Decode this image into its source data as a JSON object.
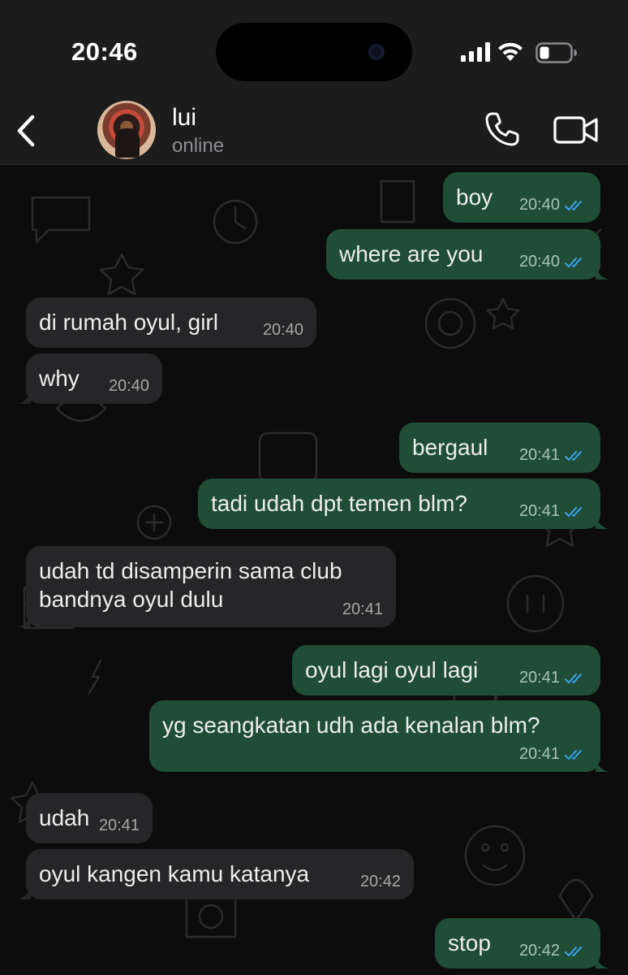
{
  "status_bar": {
    "time": "20:46",
    "icons": [
      "signal-icon",
      "wifi-icon",
      "battery-icon"
    ]
  },
  "header": {
    "contact_name": "lui",
    "contact_status": "online",
    "icons": [
      "back-chevron-icon",
      "phone-icon",
      "video-camera-icon"
    ]
  },
  "colors": {
    "outgoing_bubble": "#1f4d36",
    "incoming_bubble": "#262628",
    "read_ticks": "#3aa3f0"
  },
  "messages": [
    {
      "dir": "out",
      "text": "boy",
      "time": "20:40",
      "read": true
    },
    {
      "dir": "out",
      "text": "where are you",
      "time": "20:40",
      "read": true
    },
    {
      "dir": "in",
      "text": "di rumah oyul, girl",
      "time": "20:40"
    },
    {
      "dir": "in",
      "text": "why",
      "time": "20:40"
    },
    {
      "dir": "out",
      "text": "bergaul",
      "time": "20:41",
      "read": true
    },
    {
      "dir": "out",
      "text": "tadi udah dpt temen blm?",
      "time": "20:41",
      "read": true
    },
    {
      "dir": "in",
      "text_lines": [
        "udah td disamperin sama club",
        "bandnya oyul dulu"
      ],
      "time": "20:41"
    },
    {
      "dir": "out",
      "text": "oyul lagi oyul lagi",
      "time": "20:41",
      "read": true
    },
    {
      "dir": "out",
      "text": "yg seangkatan udh ada kenalan blm?",
      "time": "20:41",
      "read": true
    },
    {
      "dir": "in",
      "text": "udah",
      "time": "20:41"
    },
    {
      "dir": "in",
      "text": "oyul kangen kamu katanya",
      "time": "20:42"
    },
    {
      "dir": "out",
      "text": "stop",
      "time": "20:42",
      "read": true
    }
  ]
}
